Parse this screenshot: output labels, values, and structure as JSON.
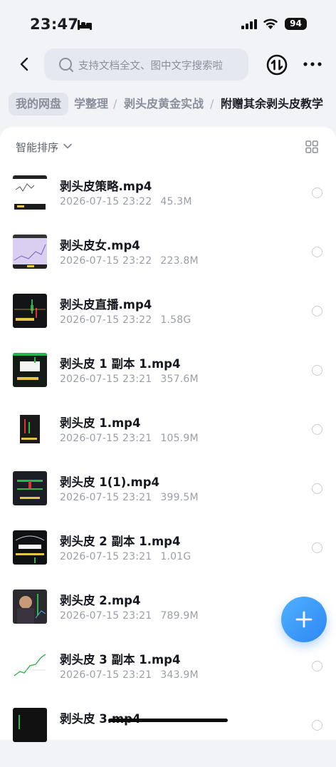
{
  "status_bar": {
    "time": "23:47",
    "battery": "94"
  },
  "header": {
    "search_placeholder": "支持文档全文、图中文字搜索啦"
  },
  "breadcrumb": {
    "root": "我的网盘",
    "items": [
      "学整理",
      "剥头皮黄金实战",
      "附赠其余剥头皮教学"
    ]
  },
  "list": {
    "sort_label": "智能排序",
    "files": [
      {
        "name": "剥头皮策略.mp4",
        "date": "2026-07-15 23:22",
        "size": "45.3M"
      },
      {
        "name": "剥头皮女.mp4",
        "date": "2026-07-15 23:22",
        "size": "223.8M"
      },
      {
        "name": "剥头皮直播.mp4",
        "date": "2026-07-15 23:22",
        "size": "1.58G"
      },
      {
        "name": "剥头皮 1 副本 1.mp4",
        "date": "2026-07-15 23:21",
        "size": "357.6M"
      },
      {
        "name": "剥头皮 1.mp4",
        "date": "2026-07-15 23:21",
        "size": "105.9M"
      },
      {
        "name": "剥头皮 1(1).mp4",
        "date": "2026-07-15 23:21",
        "size": "399.5M"
      },
      {
        "name": "剥头皮 2 副本 1.mp4",
        "date": "2026-07-15 23:21",
        "size": "1.01G"
      },
      {
        "name": "剥头皮 2.mp4",
        "date": "2026-07-15 23:21",
        "size": "789.9M"
      },
      {
        "name": "剥头皮 3 副本 1.mp4",
        "date": "2026-07-15 23:21",
        "size": "343.9M"
      },
      {
        "name": "剥头皮 3.mp4",
        "date": "",
        "size": ""
      }
    ]
  },
  "icons": {
    "back": "chevron-left-icon",
    "search": "search-icon",
    "transfer": "transfer-icon",
    "more": "more-icon",
    "sort": "chevron-down-icon",
    "grid": "grid-view-icon",
    "fab": "plus-icon"
  },
  "colors": {
    "accent": "#2f86f4",
    "background": "#f2f3f7"
  }
}
